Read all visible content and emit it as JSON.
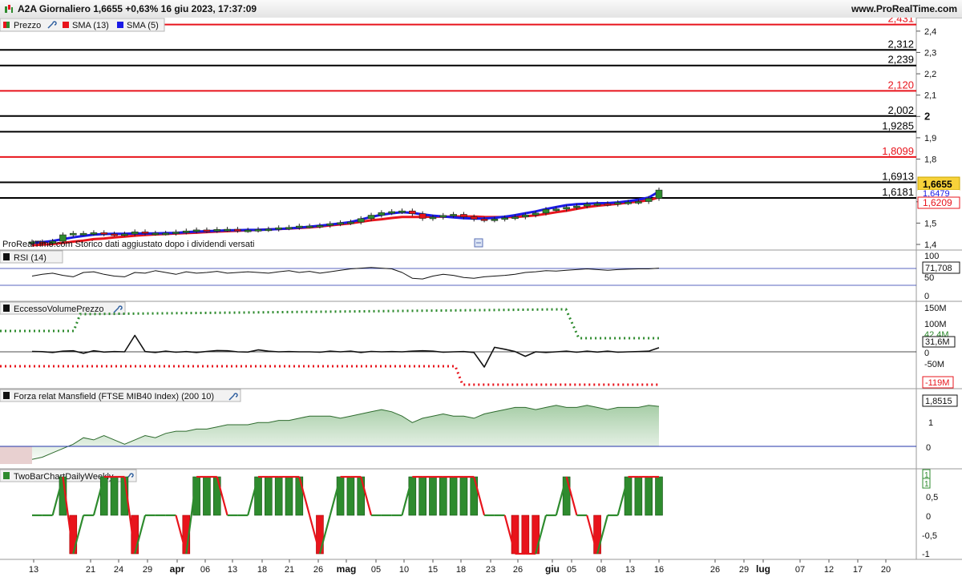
{
  "header": {
    "title": "A2A Giornaliero 1,6655 +0,63% 16 giu 2023, 17:37:09",
    "brand": "www.ProRealTime.com"
  },
  "price_panel": {
    "legend": [
      {
        "label": "Prezzo",
        "color": "#2e8b2e"
      },
      {
        "label": "SMA (13)",
        "color": "#e8141c"
      },
      {
        "label": "SMA (5)",
        "color": "#1a1ae6"
      }
    ],
    "watermark": "ProRealTime.com  Storico dati aggiustato dopo i dividendi versati",
    "axis_ticks": [
      "2,4",
      "2,3",
      "2,2",
      "2,1",
      "2",
      "1,9",
      "1,8",
      "1,6",
      "1,5",
      "1,4"
    ],
    "levels": [
      {
        "label": "2,431",
        "color": "#e8141c",
        "value": 2.431
      },
      {
        "label": "2,312",
        "color": "#000000",
        "value": 2.312
      },
      {
        "label": "2,239",
        "color": "#000000",
        "value": 2.239
      },
      {
        "label": "2,120",
        "color": "#e8141c",
        "value": 2.12
      },
      {
        "label": "2,002",
        "color": "#000000",
        "value": 2.002
      },
      {
        "label": "1,9285",
        "color": "#000000",
        "value": 1.9285
      },
      {
        "label": "1,8099",
        "color": "#e8141c",
        "value": 1.8099
      },
      {
        "label": "1,6913",
        "color": "#000000",
        "value": 1.6913
      },
      {
        "label": "1,6181",
        "color": "#000000",
        "value": 1.6181
      }
    ],
    "price_badge": "1,6655",
    "sma5_badge": "1,6479",
    "sma13_badge": "1,6209",
    "colors": {
      "up": "#2e8b2e",
      "down": "#e8141c",
      "sma13": "#e8141c",
      "sma5": "#1a1ae6"
    }
  },
  "rsi_panel": {
    "legend": "RSI (14)",
    "ticks": [
      "100",
      "50",
      "0"
    ],
    "value_badge": "71,708"
  },
  "volume_panel": {
    "legend": "EccessoVolumePrezzo",
    "ticks": [
      "150M",
      "100M",
      "-50M"
    ],
    "upper_badge": "42,4M",
    "value_badge": "31,6M",
    "zero_badge": "0",
    "lower_badge": "-119M"
  },
  "mansfield_panel": {
    "legend": "Forza relat Mansfield (FTSE MIB40 Index) (200 10)",
    "ticks": [
      "1",
      "0"
    ],
    "value_badge": "1,8515"
  },
  "twobar_panel": {
    "legend": "TwoBarChartDailyWeekly",
    "ticks": [
      "0,5",
      "0",
      "-0,5",
      "-1"
    ],
    "badge_top": "1",
    "badge_second": "1"
  },
  "x_axis": {
    "labels": [
      {
        "text": "13",
        "bold": false
      },
      {
        "text": "21",
        "bold": false
      },
      {
        "text": "24",
        "bold": false
      },
      {
        "text": "29",
        "bold": false
      },
      {
        "text": "apr",
        "bold": true
      },
      {
        "text": "06",
        "bold": false
      },
      {
        "text": "13",
        "bold": false
      },
      {
        "text": "18",
        "bold": false
      },
      {
        "text": "21",
        "bold": false
      },
      {
        "text": "26",
        "bold": false
      },
      {
        "text": "mag",
        "bold": true
      },
      {
        "text": "05",
        "bold": false
      },
      {
        "text": "10",
        "bold": false
      },
      {
        "text": "15",
        "bold": false
      },
      {
        "text": "18",
        "bold": false
      },
      {
        "text": "23",
        "bold": false
      },
      {
        "text": "26",
        "bold": false
      },
      {
        "text": "giu",
        "bold": true
      },
      {
        "text": "05",
        "bold": false
      },
      {
        "text": "08",
        "bold": false
      },
      {
        "text": "13",
        "bold": false
      },
      {
        "text": "16",
        "bold": false
      },
      {
        "text": "26",
        "bold": false
      },
      {
        "text": "29",
        "bold": false
      },
      {
        "text": "lug",
        "bold": true
      },
      {
        "text": "07",
        "bold": false
      },
      {
        "text": "12",
        "bold": false
      },
      {
        "text": "17",
        "bold": false
      },
      {
        "text": "20",
        "bold": false
      }
    ]
  },
  "chart_data": {
    "type": "candlestick",
    "title": "A2A Giornaliero",
    "close_series": [
      1.412,
      1.405,
      1.415,
      1.445,
      1.452,
      1.452,
      1.455,
      1.449,
      1.448,
      1.449,
      1.459,
      1.452,
      1.453,
      1.453,
      1.458,
      1.463,
      1.468,
      1.465,
      1.47,
      1.471,
      1.466,
      1.467,
      1.47,
      1.472,
      1.478,
      1.48,
      1.486,
      1.486,
      1.489,
      1.497,
      1.502,
      1.505,
      1.521,
      1.537,
      1.549,
      1.554,
      1.557,
      1.544,
      1.522,
      1.528,
      1.536,
      1.541,
      1.529,
      1.519,
      1.515,
      1.519,
      1.525,
      1.529,
      1.538,
      1.547,
      1.564,
      1.566,
      1.574,
      1.58,
      1.589,
      1.591,
      1.589,
      1.596,
      1.598,
      1.601,
      1.616,
      1.655
    ],
    "sma13": [
      1.396,
      1.399,
      1.402,
      1.407,
      1.413,
      1.418,
      1.425,
      1.428,
      1.433,
      1.437,
      1.441,
      1.444,
      1.447,
      1.449,
      1.451,
      1.453,
      1.455,
      1.458,
      1.46,
      1.462,
      1.464,
      1.466,
      1.468,
      1.47,
      1.472,
      1.474,
      1.477,
      1.48,
      1.484,
      1.489,
      1.494,
      1.499,
      1.506,
      1.513,
      1.518,
      1.524,
      1.529,
      1.529,
      1.529,
      1.53,
      1.53,
      1.531,
      1.531,
      1.531,
      1.529,
      1.528,
      1.528,
      1.529,
      1.532,
      1.536,
      1.543,
      1.551,
      1.558,
      1.567,
      1.575,
      1.581,
      1.586,
      1.59,
      1.596,
      1.601,
      1.607,
      1.621
    ],
    "sma5": [
      1.407,
      1.411,
      1.416,
      1.425,
      1.433,
      1.44,
      1.446,
      1.449,
      1.45,
      1.45,
      1.452,
      1.451,
      1.452,
      1.453,
      1.454,
      1.458,
      1.46,
      1.462,
      1.464,
      1.466,
      1.467,
      1.468,
      1.468,
      1.47,
      1.472,
      1.475,
      1.479,
      1.483,
      1.488,
      1.493,
      1.499,
      1.505,
      1.517,
      1.529,
      1.539,
      1.546,
      1.551,
      1.548,
      1.541,
      1.535,
      1.531,
      1.527,
      1.523,
      1.521,
      1.521,
      1.525,
      1.53,
      1.537,
      1.546,
      1.555,
      1.566,
      1.575,
      1.584,
      1.589,
      1.591,
      1.593,
      1.594,
      1.597,
      1.603,
      1.61,
      1.62,
      1.648
    ],
    "rsi": [
      50,
      55,
      58,
      52,
      48,
      60,
      62,
      55,
      50,
      48,
      60,
      58,
      65,
      60,
      55,
      62,
      58,
      60,
      63,
      58,
      60,
      62,
      60,
      58,
      62,
      65,
      60,
      63,
      58,
      62,
      66,
      70,
      72,
      74,
      72,
      70,
      60,
      44,
      42,
      50,
      55,
      52,
      46,
      44,
      48,
      50,
      52,
      55,
      60,
      62,
      65,
      64,
      66,
      68,
      70,
      68,
      66,
      68,
      69,
      70,
      70,
      72
    ],
    "volume_excess": [
      3,
      1,
      -5,
      5,
      8,
      -12,
      8,
      -2,
      2,
      0,
      128,
      2,
      -5,
      5,
      -3,
      2,
      -5,
      3,
      10,
      8,
      0,
      -2,
      15,
      5,
      0,
      2,
      0,
      0,
      -3,
      5,
      0,
      5,
      -5,
      3,
      0,
      2,
      0,
      5,
      8,
      5,
      -3,
      0,
      2,
      -5,
      -119,
      35,
      20,
      2,
      -35,
      0,
      -5,
      0,
      5,
      -3,
      5,
      -2,
      5,
      -3,
      0,
      2,
      5,
      31.6
    ],
    "mansfield": [
      -0.6,
      -0.5,
      -0.3,
      -0.1,
      0.1,
      0.4,
      0.3,
      0.5,
      0.3,
      0.1,
      0.3,
      0.5,
      0.4,
      0.6,
      0.7,
      0.7,
      0.8,
      0.8,
      0.9,
      1.0,
      1.0,
      1.0,
      1.1,
      1.1,
      1.2,
      1.2,
      1.3,
      1.4,
      1.4,
      1.4,
      1.3,
      1.4,
      1.5,
      1.6,
      1.7,
      1.6,
      1.4,
      1.1,
      1.3,
      1.4,
      1.5,
      1.4,
      1.4,
      1.3,
      1.5,
      1.6,
      1.7,
      1.8,
      1.8,
      1.7,
      1.8,
      1.9,
      1.8,
      1.8,
      1.9,
      1.8,
      1.7,
      1.8,
      1.8,
      1.8,
      1.9,
      1.85
    ],
    "twobar": [
      0,
      0,
      0,
      1,
      -1,
      0,
      0,
      1,
      1,
      1,
      -1,
      0,
      0,
      0,
      0,
      -1,
      1,
      1,
      1,
      0,
      0,
      0,
      1,
      1,
      1,
      1,
      1,
      0,
      -1,
      0,
      1,
      1,
      1,
      0,
      0,
      0,
      0,
      1,
      1,
      1,
      1,
      1,
      1,
      1,
      0,
      0,
      0,
      -1,
      -1,
      -1,
      0,
      0,
      1,
      0,
      0,
      -1,
      0,
      0,
      1,
      1,
      1,
      1
    ],
    "y_ranges": {
      "price": [
        1.4,
        2.46
      ],
      "rsi": [
        0,
        100
      ],
      "volume": [
        -119,
        150
      ],
      "mansfield": [
        -0.6,
        1.9
      ],
      "twobar": [
        -1,
        1
      ]
    }
  }
}
